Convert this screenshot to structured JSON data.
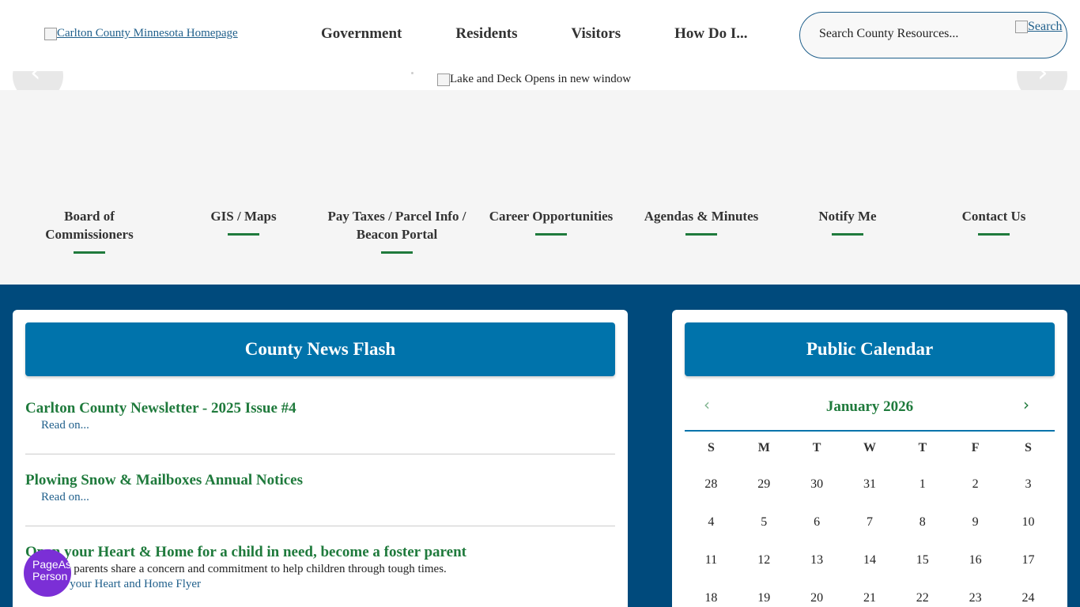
{
  "header": {
    "logo_alt": "Carlton County Minnesota Homepage",
    "nav": [
      "Government",
      "Residents",
      "Visitors",
      "How Do I..."
    ],
    "search_placeholder": "Search County Resources...",
    "search_button_alt": "Search"
  },
  "banner": {
    "image_alt": "Lake and Deck Opens in new window",
    "prev_icon": "chevron-left",
    "next_icon": "chevron-right"
  },
  "quick_links": [
    "Board of Commissioners",
    "GIS / Maps",
    "Pay Taxes / Parcel Info / Beacon Portal",
    "Career Opportunities",
    "Agendas & Minutes",
    "Notify Me",
    "Contact Us"
  ],
  "news": {
    "heading": "County News Flash",
    "items": [
      {
        "title": "Carlton County Newsletter - 2025 Issue #4",
        "more": "Read on..."
      },
      {
        "title": "Plowing Snow & Mailboxes Annual Notices",
        "more": "Read on..."
      },
      {
        "title": "Open your Heart & Home for a child in need, become a foster parent",
        "desc": "Foster parents share a concern and commitment to help children through tough times.",
        "more": "Open your Heart and Home Flyer"
      }
    ]
  },
  "calendar": {
    "heading": "Public Calendar",
    "month": "January 2026",
    "weekdays": [
      "S",
      "M",
      "T",
      "W",
      "T",
      "F",
      "S"
    ],
    "weeks": [
      [
        "28",
        "29",
        "30",
        "31",
        "1",
        "2",
        "3"
      ],
      [
        "4",
        "5",
        "6",
        "7",
        "8",
        "9",
        "10"
      ],
      [
        "11",
        "12",
        "13",
        "14",
        "15",
        "16",
        "17"
      ],
      [
        "18",
        "19",
        "20",
        "21",
        "22",
        "23",
        "24"
      ]
    ]
  },
  "fab_alt": "PageAssist Person",
  "colors": {
    "accent_green": "#1f7a3c",
    "header_blue": "#0073ab",
    "main_bg": "#004a7c",
    "fab_purple": "#7b2fd6"
  }
}
